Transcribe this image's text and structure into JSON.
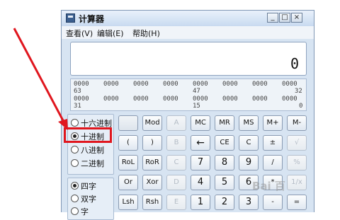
{
  "window": {
    "title": "计算器",
    "minimize": "_",
    "maximize": "□",
    "close": "×"
  },
  "menu": {
    "view": "查看(V)",
    "edit": "编辑(E)",
    "help": "帮助(H)"
  },
  "display": {
    "value": "0"
  },
  "bits": {
    "row1": [
      "0000",
      "0000",
      "0000",
      "0000",
      "0000",
      "0000",
      "0000",
      "0000"
    ],
    "row1_labels": [
      "63",
      "47",
      "32"
    ],
    "row2": [
      "0000",
      "0000",
      "0000",
      "0000",
      "0000",
      "0000",
      "0000",
      "0000"
    ],
    "row2_labels": [
      "31",
      "15",
      "0"
    ]
  },
  "base_options": [
    {
      "label": "十六进制",
      "selected": false
    },
    {
      "label": "十进制",
      "selected": true
    },
    {
      "label": "八进制",
      "selected": false
    },
    {
      "label": "二进制",
      "selected": false
    }
  ],
  "word_options": [
    {
      "label": "四字",
      "selected": true
    },
    {
      "label": "双字",
      "selected": false
    },
    {
      "label": "字",
      "selected": false
    }
  ],
  "keys": {
    "row1": [
      "",
      "Mod",
      "A",
      "MC",
      "MR",
      "MS",
      "M+",
      "M-"
    ],
    "row2": [
      "(",
      ")",
      "B",
      "←",
      "CE",
      "C",
      "±",
      "√"
    ],
    "row3": [
      "RoL",
      "RoR",
      "C",
      "7",
      "8",
      "9",
      "/",
      "%"
    ],
    "row4": [
      "Or",
      "Xor",
      "D",
      "4",
      "5",
      "6",
      "*",
      "1/x"
    ],
    "row5": [
      "Lsh",
      "Rsh",
      "E",
      "1",
      "2",
      "3",
      "-",
      "="
    ]
  },
  "watermark": "Bai 百"
}
